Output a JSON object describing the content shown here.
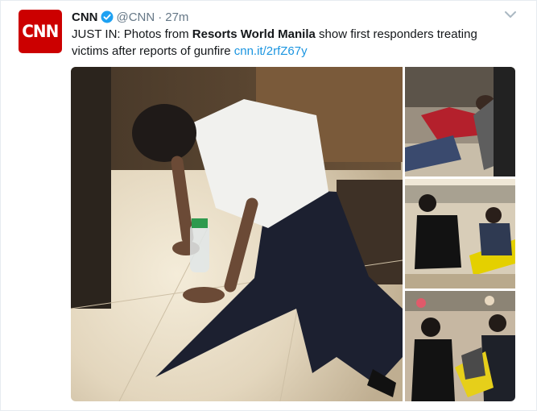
{
  "tweet": {
    "author_name": "CNN",
    "handle": "@CNN",
    "separator": "·",
    "time": "27m",
    "avatar_text": "CNN",
    "text_prefix": "JUST IN: Photos from ",
    "text_bold": "Resorts World Manila",
    "text_suffix": " show first responders treating victims after reports of gunfire ",
    "link_text": "cnn.it/2rfZ67y"
  },
  "icons": {
    "verified": "verified-badge-icon",
    "more": "chevron-down-icon"
  },
  "colors": {
    "brand_red": "#cc0000",
    "link_blue": "#1b95e0",
    "verified_blue": "#1da1f2",
    "secondary_text": "#657786"
  }
}
